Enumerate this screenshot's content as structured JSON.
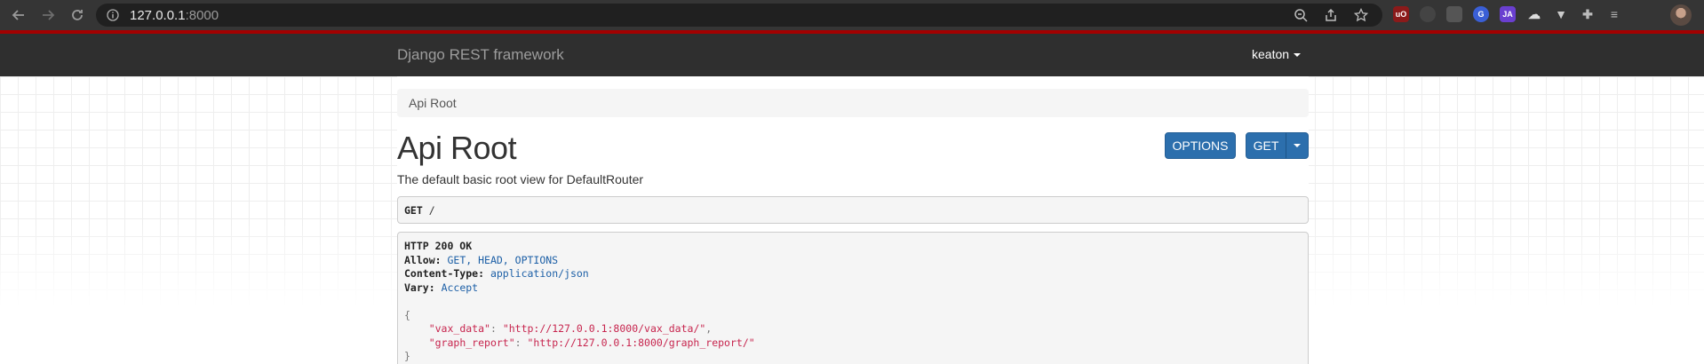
{
  "browser": {
    "url_host": "127.0.0.1",
    "url_port": ":8000"
  },
  "drf": {
    "brand": "Django REST framework",
    "username": "keaton",
    "breadcrumb": "Api Root",
    "title": "Api Root",
    "options_label": "OPTIONS",
    "get_label": "GET",
    "description": "The default basic root view for DefaultRouter",
    "request": {
      "method": "GET",
      "path": "/"
    },
    "response": {
      "status": "HTTP 200 OK",
      "allow_key": "Allow:",
      "allow_val": "GET, HEAD, OPTIONS",
      "ctype_key": "Content-Type:",
      "ctype_val": "application/json",
      "vary_key": "Vary:",
      "vary_val": "Accept",
      "open_brace": "{",
      "close_brace": "}",
      "entries": [
        {
          "key": "\"vax_data\"",
          "value": "\"http://127.0.0.1:8000/vax_data/\"",
          "trail": ","
        },
        {
          "key": "\"graph_report\"",
          "value": "\"http://127.0.0.1:8000/graph_report/\"",
          "trail": ""
        }
      ]
    }
  },
  "colors": {
    "navbar": "#2f2f2f",
    "navbar_accent": "#a30000",
    "button": "#2c6fad"
  }
}
